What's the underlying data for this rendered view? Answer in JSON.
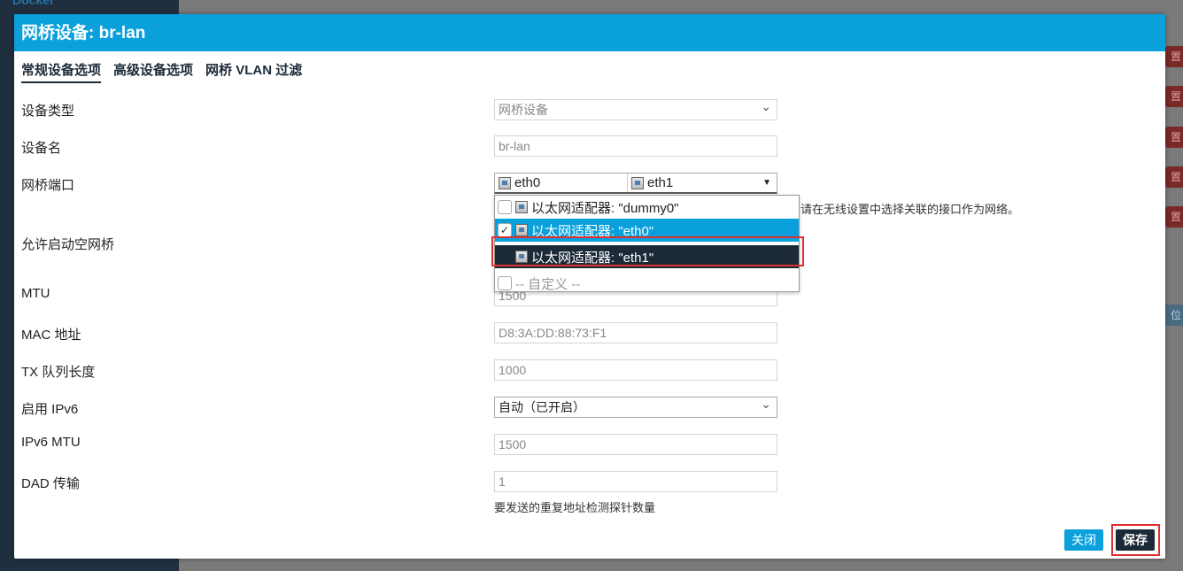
{
  "background": {
    "logo": "Docker",
    "side_buttons": [
      "置",
      "置",
      "置",
      "置",
      "置"
    ],
    "side_button_blue": "位"
  },
  "modal": {
    "title": "网桥设备: br-lan",
    "tabs": [
      {
        "label": "常规设备选项",
        "active": true
      },
      {
        "label": "高级设备选项",
        "active": false
      },
      {
        "label": "网桥 VLAN 过滤",
        "active": false
      }
    ],
    "fields": {
      "device_type": {
        "label": "设备类型",
        "value": "网桥设备"
      },
      "device_name": {
        "label": "设备名",
        "value": "br-lan"
      },
      "bridge_ports": {
        "label": "网桥端口",
        "selected": [
          "eth0",
          "eth1"
        ],
        "help": "请在无线设置中选择关联的接口作为网络。"
      },
      "allow_empty": {
        "label": "允许启动空网桥"
      },
      "mtu": {
        "label": "MTU",
        "value": "1500"
      },
      "mac": {
        "label": "MAC 地址",
        "value": "D8:3A:DD:88:73:F1"
      },
      "txqueue": {
        "label": "TX 队列长度",
        "value": "1000"
      },
      "ipv6": {
        "label": "启用 IPv6",
        "value": "自动（已开启）"
      },
      "ipv6_mtu": {
        "label": "IPv6 MTU",
        "value": "1500"
      },
      "dad": {
        "label": "DAD 传输",
        "value": "1",
        "help": "要发送的重复地址检测探针数量"
      }
    },
    "dropdown": [
      {
        "label": "以太网适配器: \"dummy0\"",
        "checked": false,
        "state": "normal"
      },
      {
        "label": "以太网适配器: \"eth0\"",
        "checked": true,
        "state": "selected"
      },
      {
        "label": "以太网适配器: \"eth1\"",
        "checked": false,
        "state": "focused"
      },
      {
        "label": "-- 自定义 --",
        "checked": false,
        "state": "custom"
      }
    ],
    "buttons": {
      "close": "关闭",
      "save": "保存"
    }
  },
  "colors": {
    "header": "#0aa0dc",
    "dark": "#1c2a38",
    "highlight": "#e03030"
  }
}
